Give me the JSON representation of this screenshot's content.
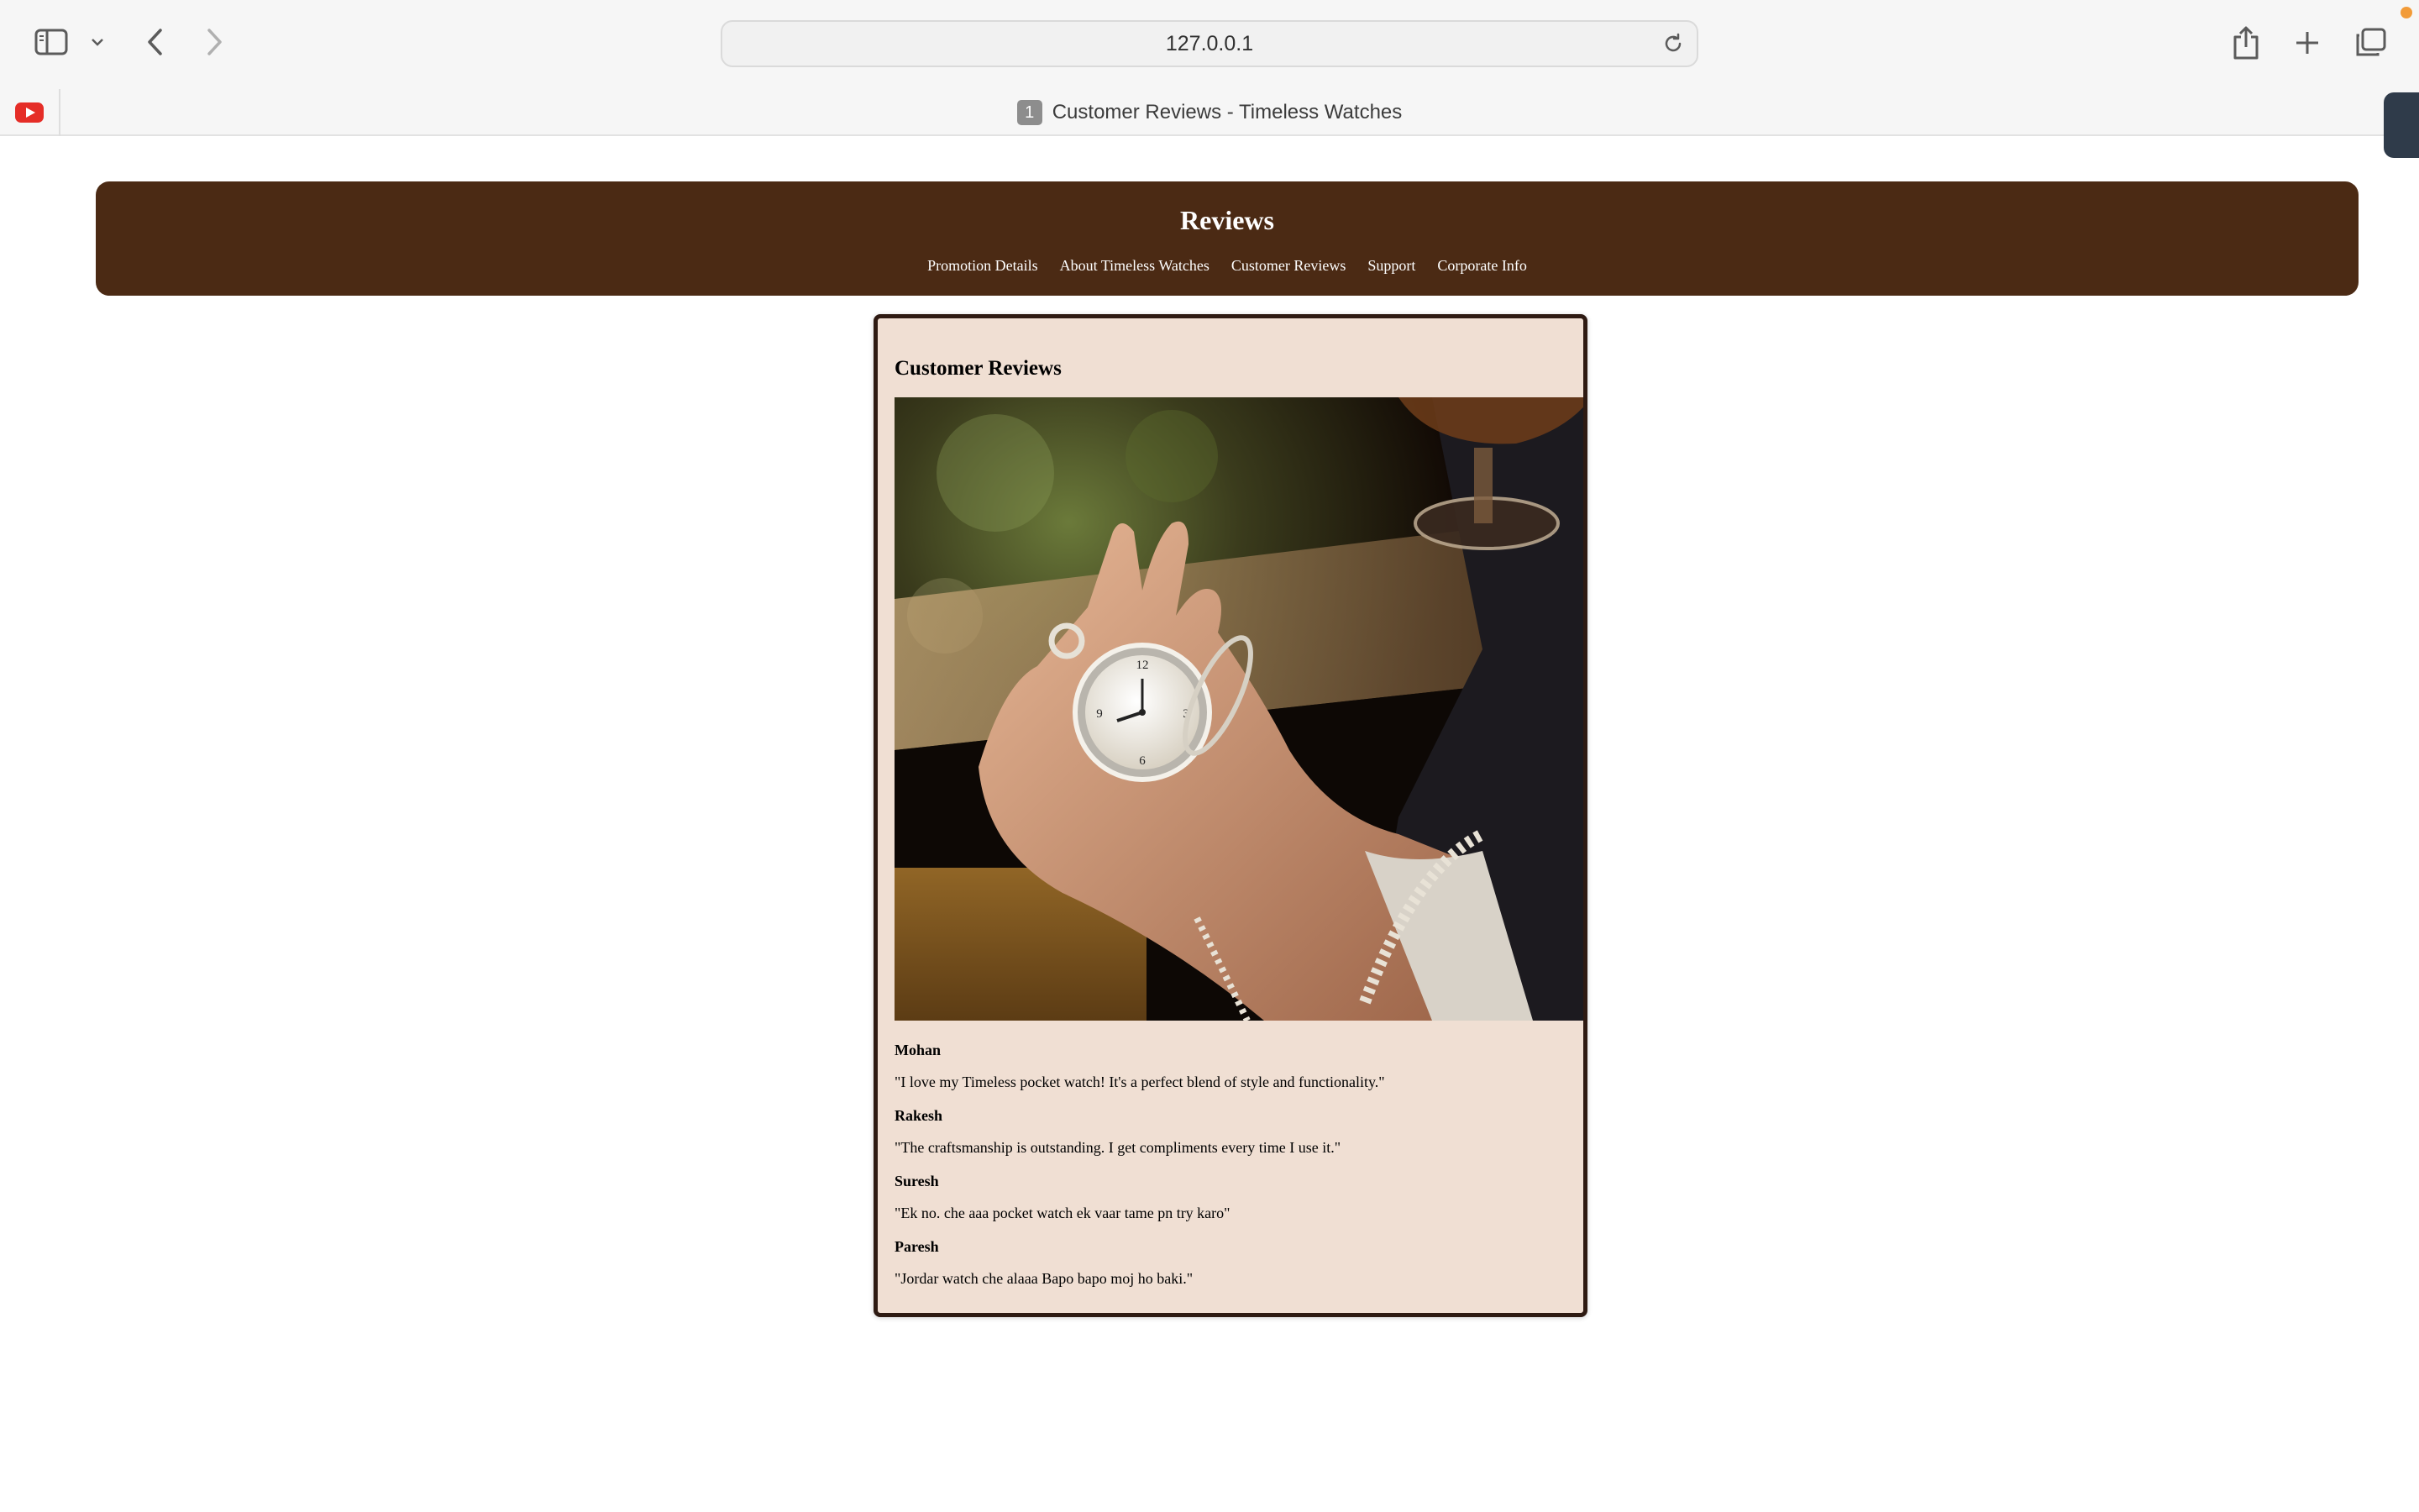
{
  "browser": {
    "url": "127.0.0.1",
    "tab_badge": "1",
    "tab_title": "Customer Reviews - Timeless Watches",
    "icons": [
      "sidebar-icon",
      "chevron-down-icon",
      "back-icon",
      "forward-icon",
      "reload-icon",
      "share-icon",
      "plus-icon",
      "tabs-overview-icon",
      "youtube-icon"
    ]
  },
  "header": {
    "title": "Reviews",
    "nav": [
      "Promotion Details",
      "About Timeless Watches",
      "Customer Reviews",
      "Support",
      "Corporate Info"
    ]
  },
  "main": {
    "heading": "Customer Reviews",
    "reviews": [
      {
        "name": "Mohan",
        "text": "\"I love my Timeless pocket watch! It's a perfect blend of style and functionality.\""
      },
      {
        "name": "Rakesh",
        "text": "\"The craftsmanship is outstanding. I get compliments every time I use it.\""
      },
      {
        "name": "Suresh",
        "text": "\"Ek no. che aaa pocket watch ek vaar tame pn try karo\""
      },
      {
        "name": "Paresh",
        "text": "\"Jordar watch che alaaa Bapo bapo moj ho baki.\""
      }
    ]
  },
  "colors": {
    "header_bg": "#4b2a14",
    "card_bg": "#f0dfd3",
    "card_border": "#2e1a12"
  }
}
